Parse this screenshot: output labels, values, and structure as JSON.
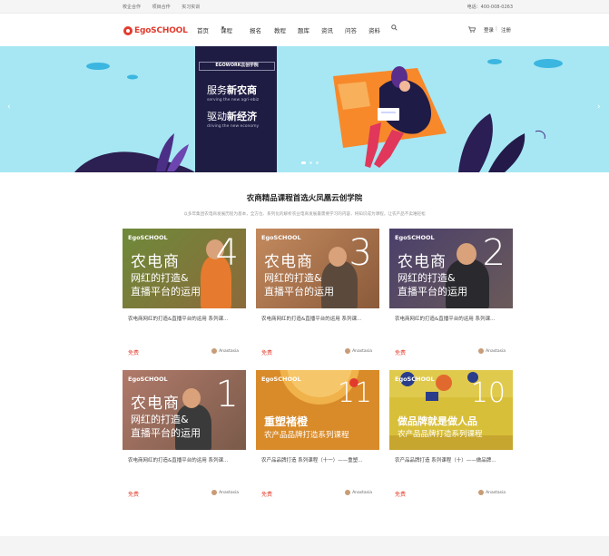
{
  "topbar": {
    "links": [
      "校企合作",
      "项目合作",
      "实习实训"
    ],
    "phone": "电话：400-008-0263"
  },
  "header": {
    "logo_text": "EgoSCHOOL",
    "nav": [
      "首页",
      "课程",
      "报名",
      "教程",
      "题库",
      "资讯",
      "问答",
      "资料"
    ],
    "login": "登录",
    "register": "注册"
  },
  "banner": {
    "tag": "EGOWORK云创学院",
    "line1_a": "服务",
    "line1_b": "新农商",
    "sub1": "serving the new agri-ebiz",
    "line2_a": "驱动",
    "line2_b": "新经济",
    "sub2": "driving the new economy",
    "prev": "‹",
    "next": "›"
  },
  "section": {
    "title": "农商精品课程首选火凤凰云创学院",
    "desc": "以多年集团农电商发展历程为基本，全方位、系列化的解析农业电商发展最需要学习的内容，将知识成为课程，让农产品不卖难轻松"
  },
  "cards": [
    {
      "brand": "EgoSCHOOL",
      "big": "农电商",
      "sub1": "网红的打造&",
      "sub2": "直播平台的运用",
      "num": "4",
      "title": "农电商网红的打造&直播平台的运用 系列课...",
      "price": "免费",
      "author": "Anastasia"
    },
    {
      "brand": "EgoSCHOOL",
      "big": "农电商",
      "sub1": "网红的打造&",
      "sub2": "直播平台的运用",
      "num": "3",
      "title": "农电商网红的打造&直播平台的运用 系列课...",
      "price": "免费",
      "author": "Anastasia"
    },
    {
      "brand": "EgoSCHOOL",
      "big": "农电商",
      "sub1": "网红的打造&",
      "sub2": "直播平台的运用",
      "num": "2",
      "title": "农电商网红的打造&直播平台的运用 系列课...",
      "price": "免费",
      "author": "Anastasia"
    },
    {
      "brand": "EgoSCHOOL",
      "big": "农电商",
      "sub1": "网红的打造&",
      "sub2": "直播平台的运用",
      "num": "1",
      "title": "农电商网红的打造&直播平台的运用 系列课...",
      "price": "免费",
      "author": "Anastasia"
    },
    {
      "brand": "EgoSCHOOL",
      "big": "重塑褚橙",
      "sub1": "农产品品牌打造系列课程",
      "sub2": "",
      "num": "11",
      "title": "农产品品牌打造 系列课程（十一）——重塑...",
      "price": "免费",
      "author": "Anastasia"
    },
    {
      "brand": "EgoSCHOOL",
      "big": "做品牌就是做人品",
      "sub1": "农产品品牌打造系列课程",
      "sub2": "",
      "num": "10",
      "title": "农产品品牌打造 系列课程（十）——做品牌...",
      "price": "免费",
      "author": "Anastasia"
    }
  ],
  "colors": {
    "accent": "#e64a3b",
    "banner_bg": "#a6e7f3",
    "banner_panel": "#1f1c43",
    "card_bg": [
      "#6e8a3a",
      "#b07a52",
      "#4a3f6b",
      "#a06a5a",
      "#d98b2a",
      "#d8bf3a"
    ]
  }
}
